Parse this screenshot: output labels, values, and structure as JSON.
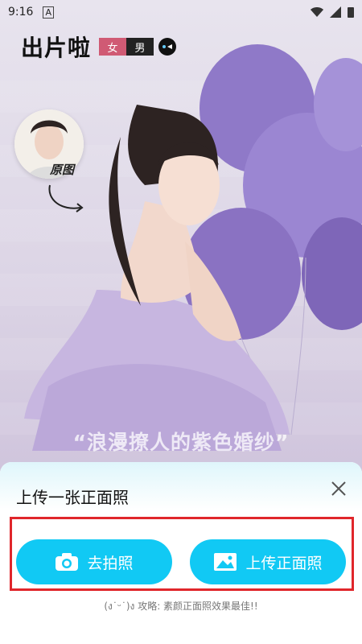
{
  "status": {
    "time": "9:16",
    "notification": "A"
  },
  "brand": {
    "logo_text": "出片啦"
  },
  "gender": {
    "female": "女",
    "male": "男"
  },
  "original": {
    "label": "原图"
  },
  "caption": "“浪漫撩人的紫色婚纱”",
  "sheet": {
    "title": "上传一张正面照",
    "camera_label": "去拍照",
    "upload_label": "上传正面照",
    "tip": "(ง˙ᵕ˙)ง 攻略: 素颜正面照效果最佳!!",
    "accent_color": "#11c9f4",
    "highlight_color": "#e0262b"
  },
  "icons": [
    "wifi-icon",
    "signal-icon",
    "battery-icon",
    "toggle-icon",
    "curved-arrow-icon",
    "close-icon",
    "camera-icon",
    "image-icon"
  ]
}
